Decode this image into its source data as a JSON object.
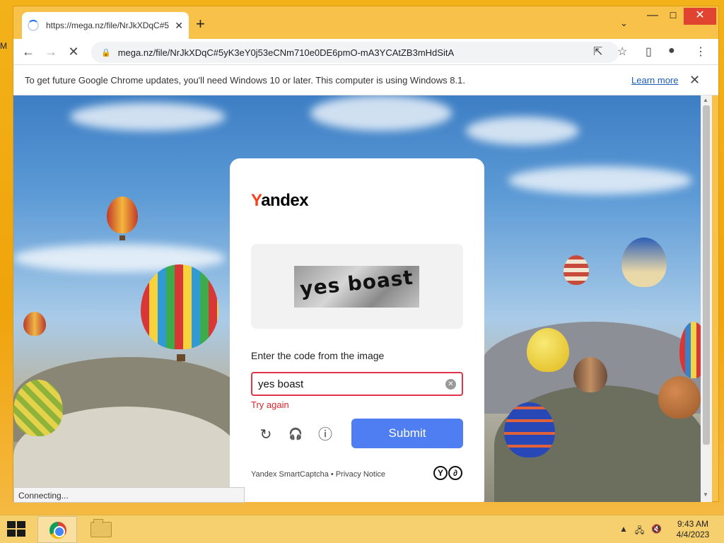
{
  "desktop": {
    "label": "M"
  },
  "browser": {
    "tab": {
      "title": "https://mega.nz/file/NrJkXDqC#5",
      "close": "✕"
    },
    "new_tab": "+",
    "tab_search": "⌄",
    "window_controls": {
      "minimize": "—",
      "maximize": "☐",
      "close": "✕"
    },
    "nav": {
      "back": "←",
      "forward": "→",
      "stop": "✕"
    },
    "address": {
      "lock": "🔒",
      "url": "mega.nz/file/NrJkXDqC#5yK3eY0j53eCNm710e0DE6pmO-mA3YCAtZB3mHdSitA"
    },
    "actions": {
      "share": "⇱",
      "bookmark": "☆",
      "sidepanel": "▯",
      "profile": "●",
      "menu": "⋮"
    },
    "infobar": {
      "message": "To get future Google Chrome updates, you'll need Windows 10 or later. This computer is using Windows 8.1.",
      "learn_more": "Learn more",
      "close": "✕"
    },
    "status": "Connecting..."
  },
  "captcha": {
    "brand_first": "Y",
    "brand_rest": "andex",
    "image_text": "yes boast",
    "prompt": "Enter the code from the image",
    "input_value": "yes boast",
    "clear": "✕",
    "error": "Try again",
    "refresh_icon": "↻",
    "audio_icon": "🎧",
    "info_icon": "ⓘ",
    "submit": "Submit",
    "footer_left": "Yandex SmartCaptcha",
    "footer_sep": "•",
    "footer_right": "Privacy Notice",
    "logo_a": "Y",
    "logo_b": "∂"
  },
  "taskbar": {
    "clock_time": "9:43 AM",
    "clock_date": "4/4/2023",
    "tray": {
      "up": "▲",
      "network": "🖧",
      "volume": "🔇"
    }
  },
  "colors": {
    "accent": "#4f7ef3",
    "error": "#d9242b",
    "yandex_red": "#fc3f1d",
    "window_close": "#e0432f"
  }
}
